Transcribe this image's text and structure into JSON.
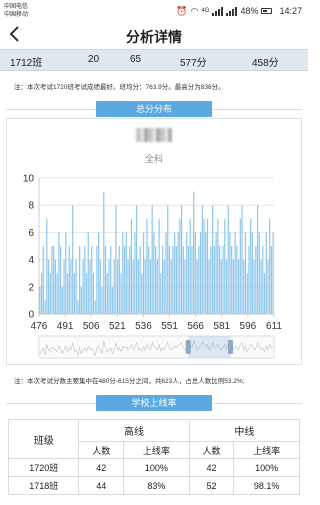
{
  "status_bar": {
    "carrier_1": "中国电信",
    "carrier_2": "中国移动",
    "network": "4G",
    "battery": "48%",
    "time": "14:27"
  },
  "nav": {
    "back_icon": "chevron-left-icon",
    "title": "分析详情"
  },
  "summary": {
    "class_name": "1712班",
    "count": "20",
    "value": "65",
    "avg_score": "577分",
    "max_score": "458分"
  },
  "note1": "注：本次考试1720班考试成绩最好。班均分：763.9分。最高分为838分。",
  "distribution": {
    "header": "总分分布",
    "subject_label": "全科"
  },
  "note2": "注：本次考试分数主要集中在480分-615分之间，共623人，占总人数比例53.2%;",
  "line_rate": {
    "header": "学校上线率",
    "col_class": "班级",
    "col_high": "高线",
    "col_mid": "中线",
    "sub_count": "人数",
    "sub_rate": "上线率",
    "rows": [
      {
        "class": "1720班",
        "high_count": "42",
        "high_rate": "100%",
        "mid_count": "42",
        "mid_rate": "100%"
      },
      {
        "class": "1718班",
        "high_count": "44",
        "high_rate": "83%",
        "mid_count": "52",
        "mid_rate": "98.1%"
      }
    ]
  },
  "colors": {
    "bar": "#8fc7ec",
    "header_blue": "#5ba9e0",
    "summary_bg": "#dfe8ef"
  },
  "chart_data": {
    "type": "bar",
    "x_start": 476,
    "x_end": 611,
    "ylim": [
      0,
      10
    ],
    "y_ticks": [
      "0",
      "2",
      "4",
      "6",
      "8",
      "10"
    ],
    "x_ticks": [
      "476",
      "491",
      "506",
      "521",
      "536",
      "551",
      "566",
      "581",
      "596",
      "611"
    ],
    "values": [
      2,
      3,
      5,
      1,
      7,
      4,
      3,
      5,
      5,
      4,
      3,
      6,
      5,
      2,
      4,
      6,
      3,
      5,
      4,
      8,
      3,
      4,
      1,
      5,
      2,
      4,
      5,
      3,
      6,
      4,
      5,
      3,
      1,
      5,
      6,
      4,
      2,
      9,
      5,
      3,
      4,
      5,
      2,
      4,
      8,
      4,
      5,
      3,
      6,
      5,
      6,
      4,
      5,
      7,
      4,
      6,
      8,
      4,
      5,
      3,
      6,
      4,
      7,
      5,
      4,
      8,
      6,
      5,
      4,
      7,
      3,
      5,
      4,
      6,
      8,
      5,
      4,
      5,
      6,
      5,
      6,
      7,
      8,
      5,
      4,
      6,
      5,
      7,
      5,
      9,
      6,
      4,
      5,
      6,
      8,
      7,
      6,
      7,
      4,
      5,
      8,
      5,
      6,
      7,
      5,
      4,
      5,
      7,
      4,
      8,
      6,
      5,
      4,
      6,
      5,
      4,
      7,
      8,
      4,
      6,
      3,
      5,
      7,
      6,
      4,
      5,
      8,
      6,
      4,
      5,
      3,
      6,
      4,
      7,
      5,
      6
    ]
  }
}
